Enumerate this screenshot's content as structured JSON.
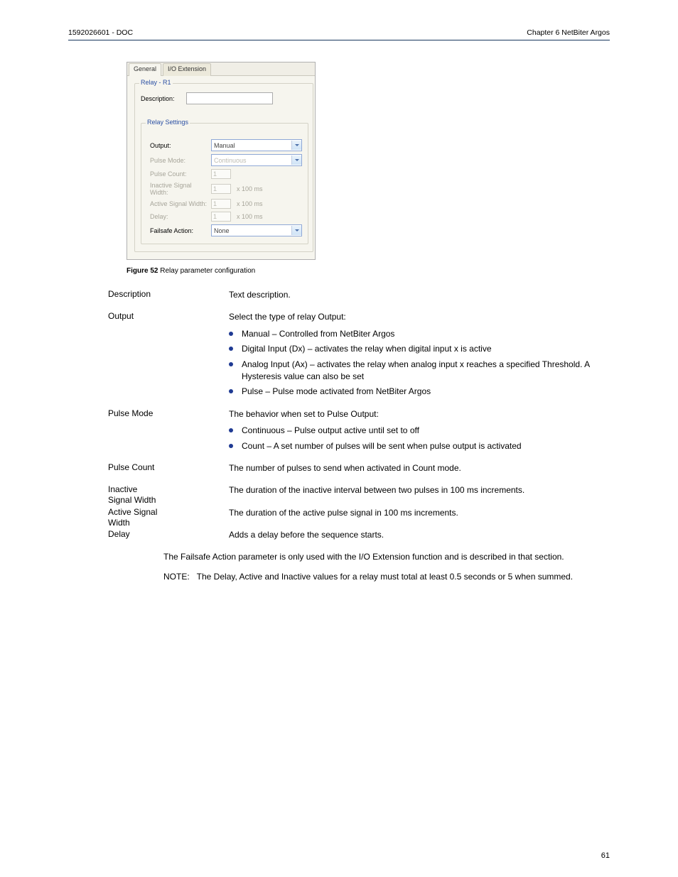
{
  "header": {
    "left": "1592026601 - DOC",
    "right": "Chapter 6 NetBiter Argos"
  },
  "dialog": {
    "tabs": {
      "general": "General",
      "io_extension": "I/O Extension"
    },
    "group_title": "Relay - R1",
    "description_label": "Description:",
    "inner_group_title": "Relay Settings",
    "rows": {
      "output": {
        "label": "Output:",
        "value": "Manual"
      },
      "pulse_mode": {
        "label": "Pulse Mode:",
        "value": "Continuous"
      },
      "pulse_count": {
        "label": "Pulse Count:",
        "value": "1"
      },
      "inactive": {
        "label": "Inactive Signal Width:",
        "value": "1",
        "suffix": "x 100 ms"
      },
      "active": {
        "label": "Active Signal Width:",
        "value": "1",
        "suffix": "x 100 ms"
      },
      "delay": {
        "label": "Delay:",
        "value": "1",
        "suffix": "x 100 ms"
      },
      "failsafe": {
        "label": "Failsafe Action:",
        "value": "None"
      }
    }
  },
  "caption": {
    "label": "Figure 52",
    "text": "Relay parameter configuration"
  },
  "sections": {
    "description": {
      "head": "Description",
      "body": "Text description."
    },
    "output": {
      "head": "Output",
      "intro": "Select the type of relay Output:",
      "bullets": [
        "Manual – Controlled from NetBiter Argos ",
        "Digital Input (Dx) – activates the relay when digital input x is active",
        "Analog Input (Ax) – activates the relay when analog input x reaches a specified Threshold. A Hysteresis value can also be set",
        "Pulse – Pulse mode activated from NetBiter Argos"
      ]
    },
    "pulse_mode": {
      "head": "Pulse Mode",
      "intro": "The behavior when set to Pulse Output:",
      "bullets": [
        "Continuous – Pulse output active until set to off",
        "Count – A set number of pulses will be sent when pulse output is activated"
      ]
    },
    "pulse_count": {
      "head": "Pulse Count",
      "body": "The number of pulses to send when activated in Count mode."
    },
    "inactive_signal_width": {
      "head": "Inactive Signal Width",
      "body": "The duration of the inactive interval between two pulses in 100 ms increments."
    },
    "active_signal_width": {
      "head": "Active Signal Width",
      "body": "The duration of the active pulse signal in 100 ms increments."
    },
    "delay": {
      "head": "Delay",
      "body": "Adds a delay before the sequence starts."
    },
    "failsafe_text": "The Failsafe Action parameter is only used with the I/O Extension function and is described in that section.",
    "note": {
      "label": "NOTE:",
      "text": "The Delay, Active and Inactive values for a relay must total at least 0.5 seconds or 5 when summed."
    }
  },
  "page_number": "61"
}
